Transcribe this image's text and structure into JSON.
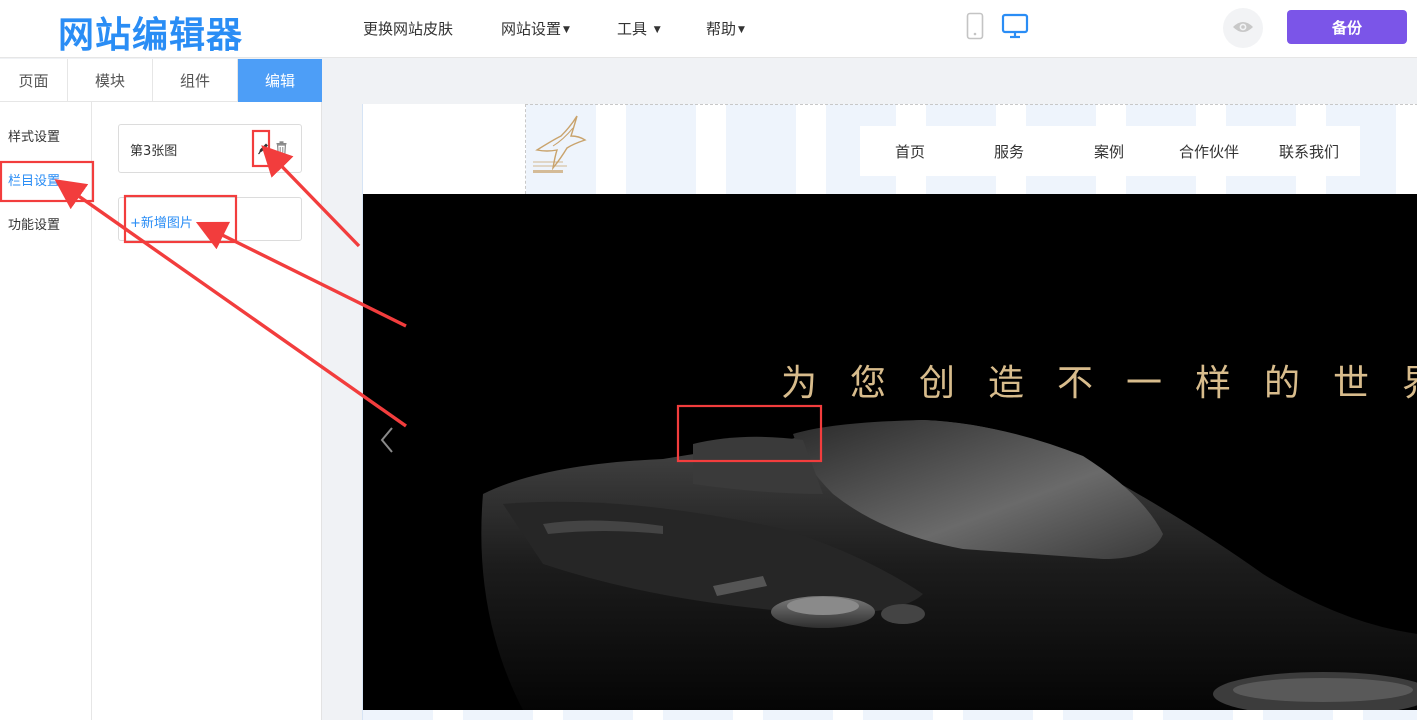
{
  "app": {
    "logo": "网站编辑器",
    "menu": [
      "更换网站皮肤",
      "网站设置",
      "工具",
      "帮助"
    ],
    "backup_label": "备份",
    "icons": {
      "mobile": "mobile-device-icon",
      "desktop": "desktop-device-icon",
      "preview": "eye-icon"
    },
    "accent_color": "#2a8df5",
    "backup_color": "#7b55e8"
  },
  "panel": {
    "tabs": [
      "页面",
      "模块",
      "组件",
      "编辑"
    ],
    "active_tab": "编辑",
    "side_menu": [
      "样式设置",
      "栏目设置",
      "功能设置"
    ],
    "active_side_item": "栏目设置",
    "image_item": "第3张图",
    "add_image": "+新增图片"
  },
  "site": {
    "nav": [
      "首页",
      "服务",
      "案例",
      "合作伙伴",
      "联系我们"
    ],
    "hero_text": "为您创造不一样的世界"
  },
  "annotation_color": "#f23d3d"
}
